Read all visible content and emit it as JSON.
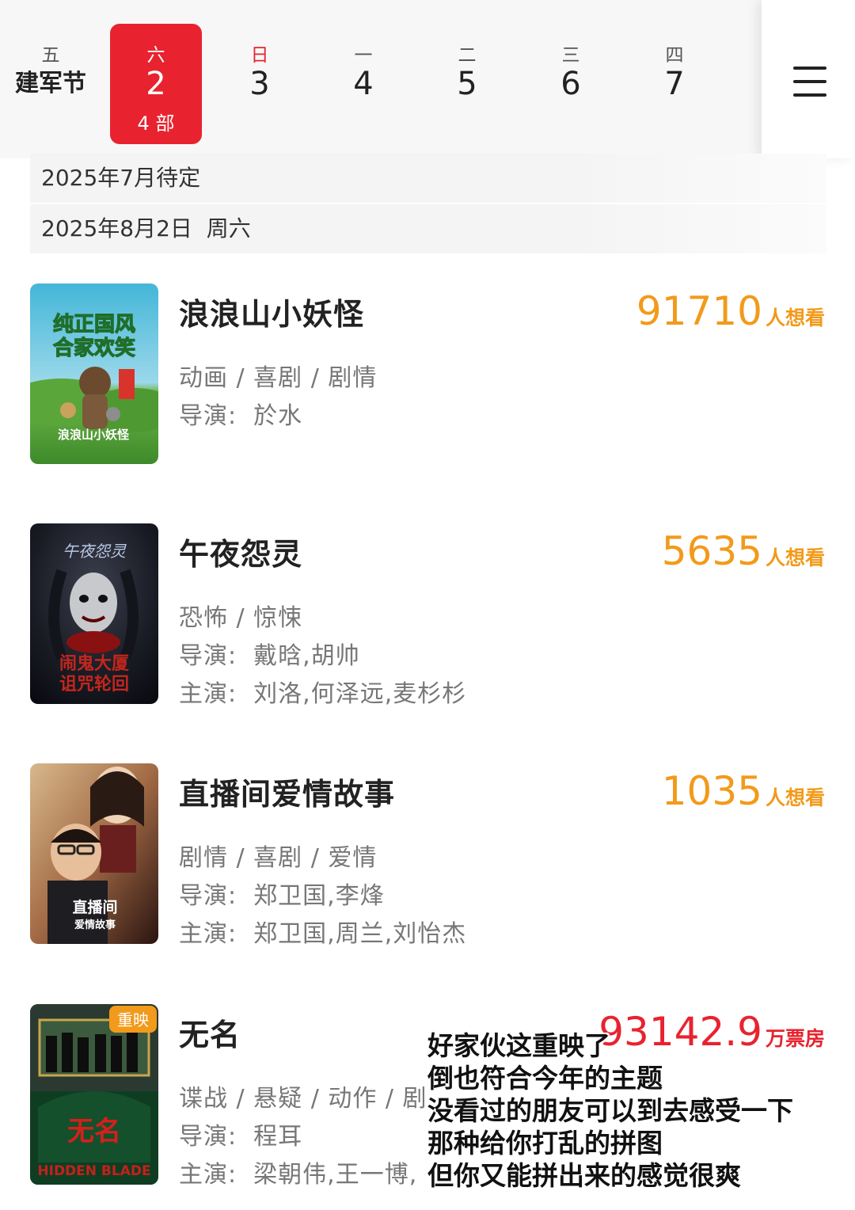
{
  "date_strip": {
    "days": [
      {
        "weekday": "五",
        "label": "建军节",
        "active": false
      },
      {
        "weekday": "六",
        "label": "2",
        "count": "4 部",
        "active": true
      },
      {
        "weekday": "日",
        "label": "3",
        "active": false,
        "sunday": true
      },
      {
        "weekday": "一",
        "label": "4",
        "active": false
      },
      {
        "weekday": "二",
        "label": "5",
        "active": false
      },
      {
        "weekday": "三",
        "label": "6",
        "active": false
      },
      {
        "weekday": "四",
        "label": "7",
        "active": false
      }
    ],
    "active_color": "#e8232f",
    "menu_icon": "hamburger-menu-icon"
  },
  "sections": [
    {
      "heading": "2025年7月待定"
    },
    {
      "heading": "2025年8月2日  周六"
    }
  ],
  "movies": [
    {
      "title": "浪浪山小妖怪",
      "stat_value": "91710",
      "stat_unit": "人想看",
      "genres": "动画 / 喜剧 / 剧情",
      "director": "导演:  於水",
      "poster_text": "纯正国风\n合家欢笑",
      "poster_logo": "浪浪山小妖怪"
    },
    {
      "title": "午夜怨灵",
      "stat_value": "5635",
      "stat_unit": "人想看",
      "genres": "恐怖 / 惊悚",
      "director": "导演:  戴晗,胡帅",
      "cast": "主演:  刘洛,何泽远,麦杉杉",
      "poster_text": "闹鬼大厦\n诅咒轮回"
    },
    {
      "title": "直播间爱情故事",
      "stat_value": "1035",
      "stat_unit": "人想看",
      "genres": "剧情 / 喜剧 / 爱情",
      "director": "导演:  郑卫国,李烽",
      "cast": "主演:  郑卫国,周兰,刘怡杰",
      "poster_text": "直播间\n爱情故事"
    },
    {
      "title": "无名",
      "stat_value": "93142.9",
      "stat_unit": "万票房",
      "genres": "谍战 / 悬疑 / 动作 / 剧",
      "director": "导演:  程耳",
      "cast": "主演:  梁朝伟,王一博,",
      "badge": "重映",
      "poster_text": "无名",
      "poster_en": "HIDDEN BLADE"
    }
  ],
  "caption_lines": [
    "好家伙这重映了",
    "倒也符合今年的主题",
    "没看过的朋友可以到去感受一下",
    "那种给你打乱的拼图",
    "但你又能拼出来的感觉很爽"
  ],
  "colors": {
    "accent_red": "#e8232f",
    "want_orange": "#f29a1b",
    "box_office_red": "#e8232f"
  }
}
